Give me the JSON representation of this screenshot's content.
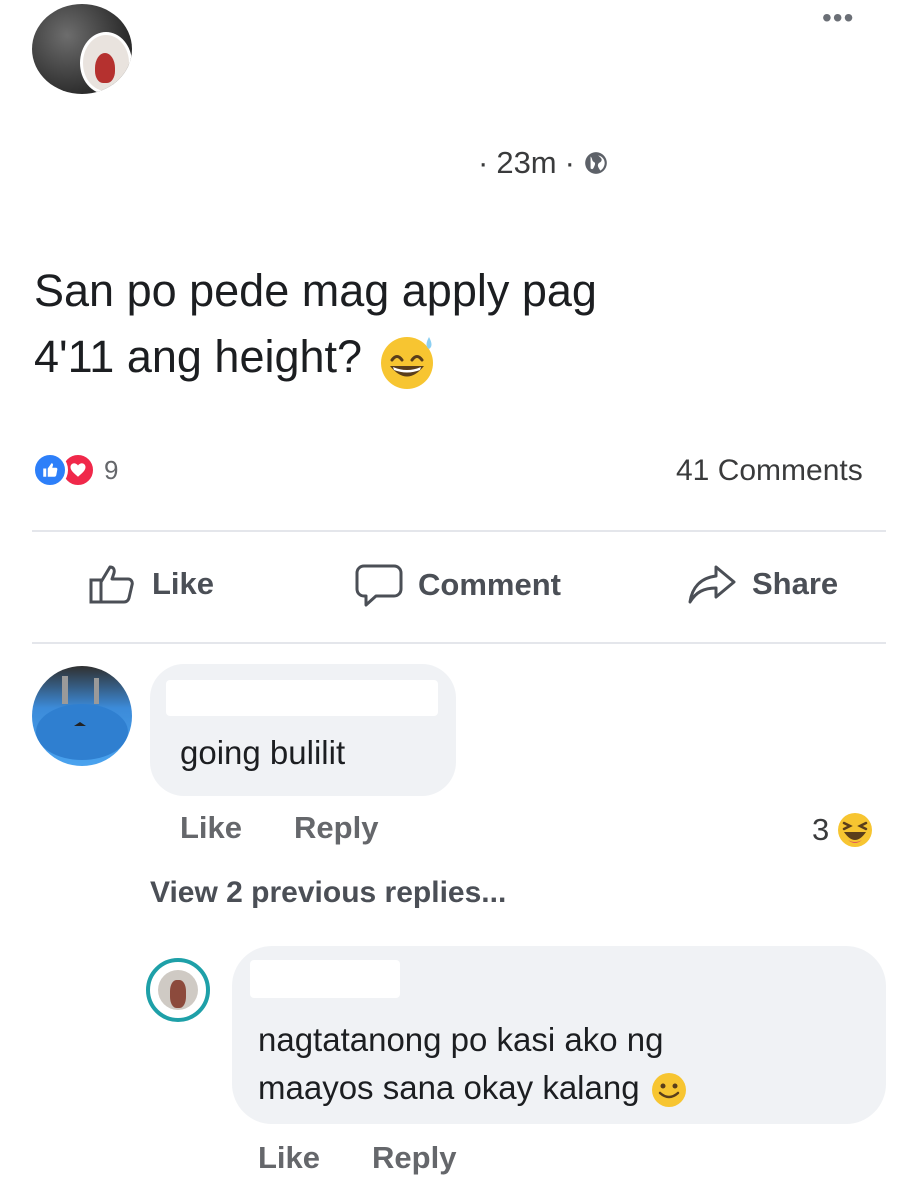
{
  "post": {
    "more_icon": "more-dots-icon",
    "time": "23m",
    "separator": "·",
    "privacy_icon": "globe-icon",
    "text_line1": "San po pede mag apply pag",
    "text_line2": "4'11 ang height?",
    "emoji": "grinning-sweat-emoji",
    "reaction_icons": [
      "like-reaction-icon",
      "love-reaction-icon"
    ],
    "reaction_count": "9",
    "comments_count": "41 Comments"
  },
  "actions": {
    "like": "Like",
    "comment": "Comment",
    "share": "Share"
  },
  "comments": [
    {
      "text": "going bulilit",
      "like": "Like",
      "reply": "Reply",
      "reaction_count": "3",
      "reaction_icon": "haha-reaction-icon"
    }
  ],
  "view_replies": "View 2 previous replies...",
  "reply": {
    "text_line1": "nagtatanong po kasi ako ng",
    "text_line2": "maayos sana okay kalang",
    "emoji": "smile-emoji",
    "like": "Like",
    "reply": "Reply"
  },
  "colors": {
    "like_blue": "#2d7ff9",
    "love_red": "#f0284a",
    "bubble_gray": "#f0f2f5",
    "muted_text": "#65676b"
  }
}
